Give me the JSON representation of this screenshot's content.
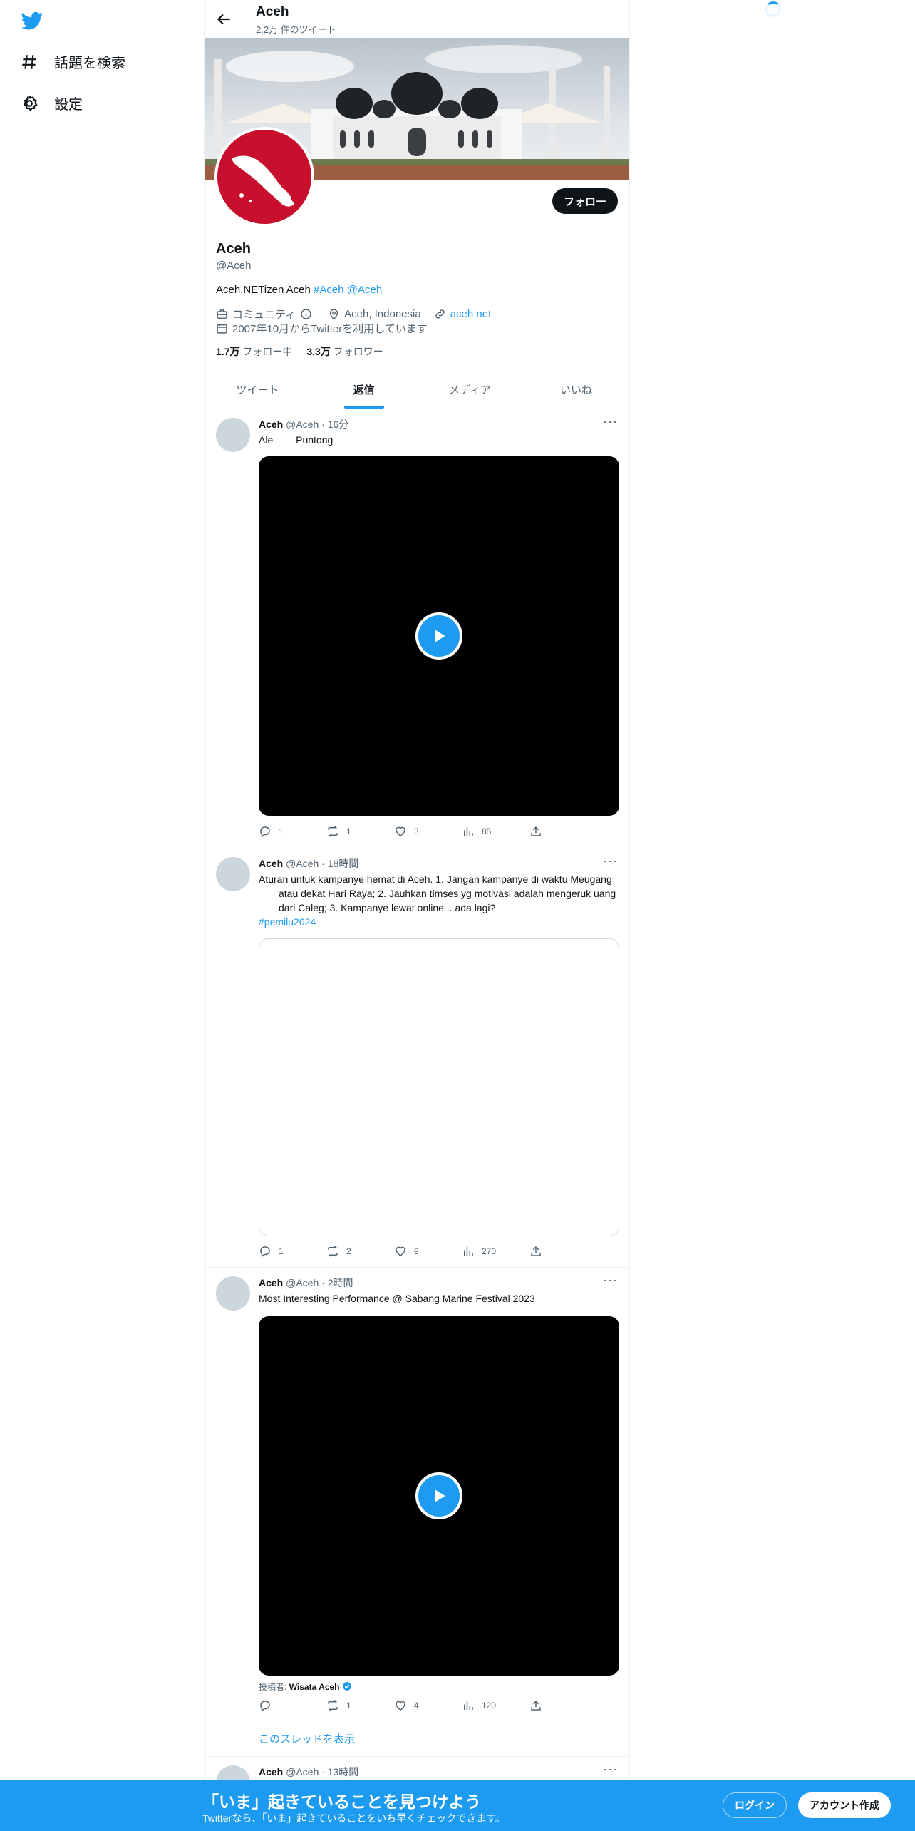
{
  "sidebar": {
    "logo": "twitter-bird-icon",
    "items": [
      {
        "label": "話題を検索",
        "icon": "hashtag-icon"
      },
      {
        "label": "設定",
        "icon": "gear-icon"
      }
    ]
  },
  "header": {
    "name": "Aceh",
    "tweet_count": "2.2万 件のツイート"
  },
  "profile": {
    "follow_label": "フォロー",
    "name": "Aceh",
    "handle": "@Aceh",
    "bio_text": "Aceh.NETizen Aceh",
    "bio_tags": [
      "#Aceh",
      "@Aceh"
    ],
    "category": "コミュニティ",
    "location": "Aceh, Indonesia",
    "url": "aceh.net",
    "joined": "2007年10月からTwitterを利用しています",
    "following_count": "1.7万",
    "following_label": "フォロー中",
    "followers_count": "3.3万",
    "followers_label": "フォロワー"
  },
  "tabs": [
    {
      "label": "ツイート",
      "active": false
    },
    {
      "label": "返信",
      "active": true
    },
    {
      "label": "メディア",
      "active": false
    },
    {
      "label": "いいね",
      "active": false
    }
  ],
  "tweets": [
    {
      "name": "Aceh",
      "handle": "@Aceh",
      "time": "16分",
      "text": "Ale 　　Puntong",
      "media": "video",
      "replies": "1",
      "retweets": "1",
      "likes": "3",
      "views": "85"
    },
    {
      "name": "Aceh",
      "handle": "@Aceh",
      "time": "18時間",
      "text": "Aturan untuk kampanye hemat di Aceh. 1. Jangan kampanye di waktu Meugang 　　atau dekat Hari Raya; 2. Jauhkan timses yg motivasi adalah mengeruk uang 　　dari Caleg; 3. Kampanye lewat online .. ada lagi?",
      "hashtag": "#pemilu2024",
      "media": "card",
      "replies": "1",
      "retweets": "2",
      "likes": "9",
      "views": "270"
    },
    {
      "name": "Aceh",
      "handle": "@Aceh",
      "time": "2時間",
      "text": "Most Interesting Performance @ Sabang Marine Festival 2023",
      "media": "video",
      "posted_by_label": "投稿者:",
      "posted_by": "Wisata Aceh",
      "replies": "",
      "retweets": "1",
      "likes": "4",
      "views": "120",
      "thread_label": "このスレッドを表示"
    },
    {
      "name": "Aceh",
      "handle": "@Aceh",
      "time": "13時間"
    }
  ],
  "bottom_bar": {
    "title": "「いま」起きていることを見つけよう",
    "subtitle": "Twitterなら、「いま」起きていることをいち早くチェックできます。",
    "login": "ログイン",
    "signup": "アカウント作成"
  },
  "colors": {
    "accent": "#1d9bf0",
    "text": "#0f1419",
    "muted": "#536471",
    "avatar_red": "#c8102e"
  }
}
